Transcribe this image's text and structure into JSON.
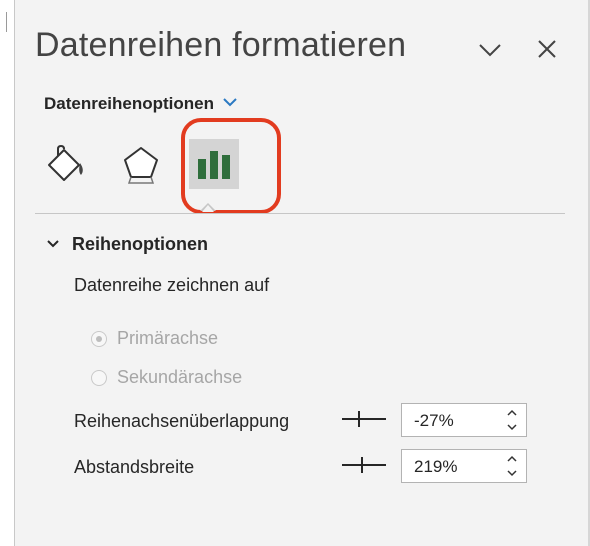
{
  "pane": {
    "title": "Datenreihen formatieren",
    "options_dropdown_label": "Datenreihenoptionen",
    "tabs": [
      {
        "name": "fill-line",
        "icon": "paint-bucket-icon",
        "active": false
      },
      {
        "name": "effects",
        "icon": "pentagon-icon",
        "active": false
      },
      {
        "name": "series-options",
        "icon": "bar-chart-icon",
        "active": true
      }
    ],
    "section": {
      "title": "Reihenoptionen",
      "plot_on_label": "Datenreihe zeichnen auf",
      "radios": [
        {
          "label": "Primärachse",
          "checked": true,
          "disabled": true
        },
        {
          "label": "Sekundärachse",
          "checked": false,
          "disabled": true
        }
      ],
      "overlap": {
        "label": "Reihenachsenüberlappung",
        "value": "-27%",
        "slider_fraction": 0.365
      },
      "gap_width": {
        "label": "Abstandsbreite",
        "value": "219%",
        "slider_fraction": 0.438
      }
    }
  },
  "colors": {
    "highlight": "#e23b1f",
    "accent": "#2b79c2",
    "chart_icon": "#2f6e3c"
  }
}
